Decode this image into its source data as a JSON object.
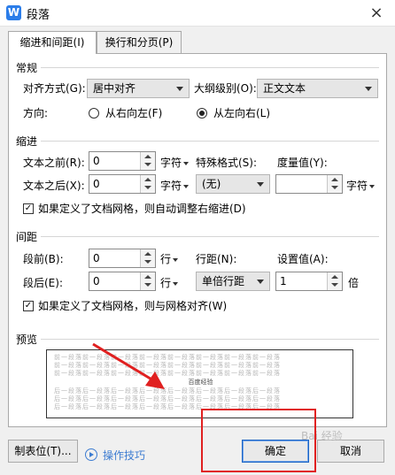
{
  "window": {
    "title": "段落",
    "app_icon_letter": "W",
    "close_glyph": "×"
  },
  "tabs": [
    {
      "label": "缩进和间距(I)",
      "active": true
    },
    {
      "label": "换行和分页(P)",
      "active": false
    }
  ],
  "general": {
    "heading": "常规",
    "alignment_label": "对齐方式(G):",
    "alignment_value": "居中对齐",
    "outline_label": "大纲级别(O):",
    "outline_value": "正文文本",
    "direction_label": "方向:",
    "rtl_label": "从右向左(F)",
    "ltr_label": "从左向右(L)",
    "direction_selected": "ltr"
  },
  "indent": {
    "heading": "缩进",
    "before_label": "文本之前(R):",
    "before_value": "0",
    "before_unit": "字符",
    "after_label": "文本之后(X):",
    "after_value": "0",
    "after_unit": "字符",
    "special_label": "特殊格式(S):",
    "special_value": "(无)",
    "measure_label": "度量值(Y):",
    "measure_value": "",
    "measure_unit": "字符",
    "auto_adjust_label": "如果定义了文档网格，则自动调整右缩进(D)",
    "auto_adjust_checked": true
  },
  "spacing": {
    "heading": "间距",
    "before_label": "段前(B):",
    "before_value": "0",
    "before_unit": "行",
    "after_label": "段后(E):",
    "after_value": "0",
    "after_unit": "行",
    "line_label": "行距(N):",
    "line_value": "单倍行距",
    "set_label": "设置值(A):",
    "set_value": "1",
    "set_unit": "倍",
    "grid_label": "如果定义了文档网格，则与网格对齐(W)",
    "grid_checked": true
  },
  "preview": {
    "heading": "预览",
    "before_text": "前一段落前一段落前一段落前一段落前一段落前一段落前一段落前一段落",
    "sample_text": "百度经验",
    "after_text": "后一段落后一段落后一段落后一段落后一段落后一段落后一段落后一段落"
  },
  "footer": {
    "tabs_button": "制表位(T)...",
    "tips_link": "操作技巧",
    "ok_button": "确定",
    "cancel_button": "取消",
    "watermark": "Bai 经验"
  },
  "colors": {
    "annotation_red": "#e02020",
    "link_blue": "#3d7cd1",
    "app_blue": "#2b7de9"
  }
}
